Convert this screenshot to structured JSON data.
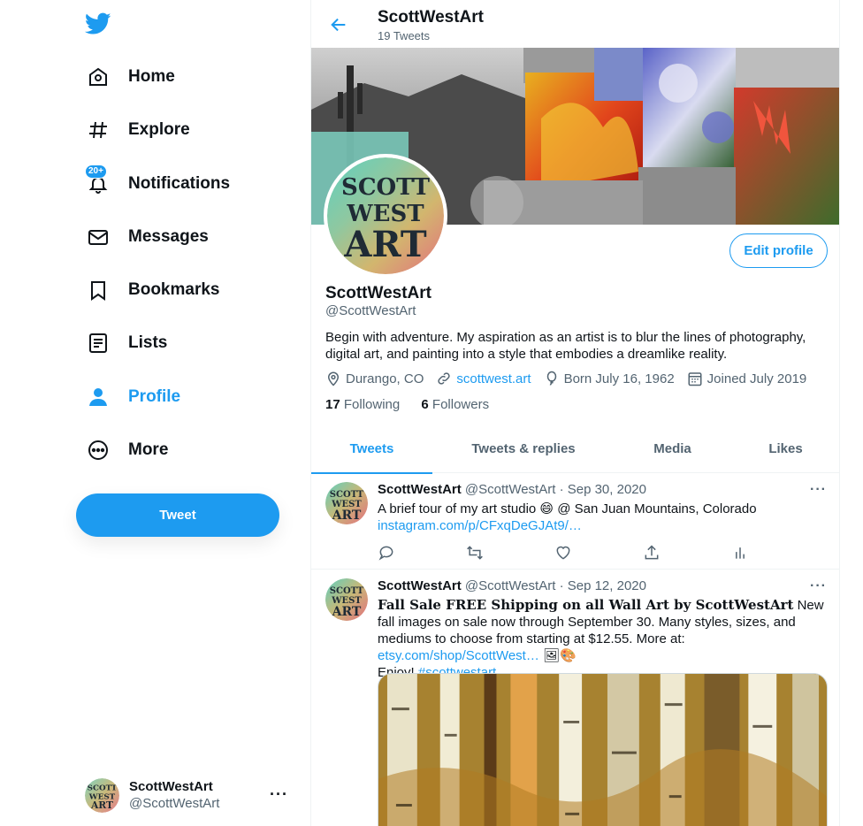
{
  "nav": {
    "items": [
      {
        "label": "Home",
        "icon": "home-icon"
      },
      {
        "label": "Explore",
        "icon": "hashtag-icon"
      },
      {
        "label": "Notifications",
        "icon": "bell-icon",
        "badge": "20+"
      },
      {
        "label": "Messages",
        "icon": "envelope-icon"
      },
      {
        "label": "Bookmarks",
        "icon": "bookmark-icon"
      },
      {
        "label": "Lists",
        "icon": "list-icon"
      },
      {
        "label": "Profile",
        "icon": "person-icon",
        "active": true
      },
      {
        "label": "More",
        "icon": "more-circle-icon"
      }
    ],
    "tweet_button": "Tweet",
    "account": {
      "name": "ScottWestArt",
      "handle": "@ScottWestArt"
    }
  },
  "header": {
    "title": "ScottWestArt",
    "subtitle": "19 Tweets"
  },
  "profile": {
    "edit_button": "Edit profile",
    "name": "ScottWestArt",
    "handle": "@ScottWestArt",
    "bio": "Begin with adventure. My aspiration as an artist is to blur the lines of photography, digital art, and painting into a style that embodies a dreamlike reality.",
    "location": "Durango, CO",
    "website": "scottwest.art",
    "born": "Born July 16, 1962",
    "joined": "Joined July 2019",
    "following_count": "17",
    "following_label": "Following",
    "followers_count": "6",
    "followers_label": "Followers",
    "avatar_text": [
      "SCOTT",
      "WEST",
      "ART"
    ]
  },
  "tabs": [
    "Tweets",
    "Tweets & replies",
    "Media",
    "Likes"
  ],
  "tweets": [
    {
      "name": "ScottWestArt",
      "handle": "@ScottWestArt",
      "date": "· Sep 30, 2020",
      "text": "A brief tour of my art studio 😄 @ San Juan Mountains, Colorado",
      "link": "instagram.com/p/CFxqDeGJAt9/…"
    },
    {
      "name": "ScottWestArt",
      "handle": "@ScottWestArt",
      "date": "· Sep 12, 2020",
      "bold_text": "Fall Sale FREE Shipping on all Wall Art by ScottWestArt",
      "text": " New fall images on sale now through September 30. Many styles, sizes, and mediums to choose from starting at $12.55.  More at: ",
      "link": "etsy.com/shop/ScottWest…",
      "emoji": " 🖼🎨",
      "text2": "Enjoy! ",
      "hashtag": "#scottwestart"
    }
  ],
  "colors": {
    "accent": "#1d9bf0",
    "text": "#0f1419",
    "muted": "#536471"
  }
}
